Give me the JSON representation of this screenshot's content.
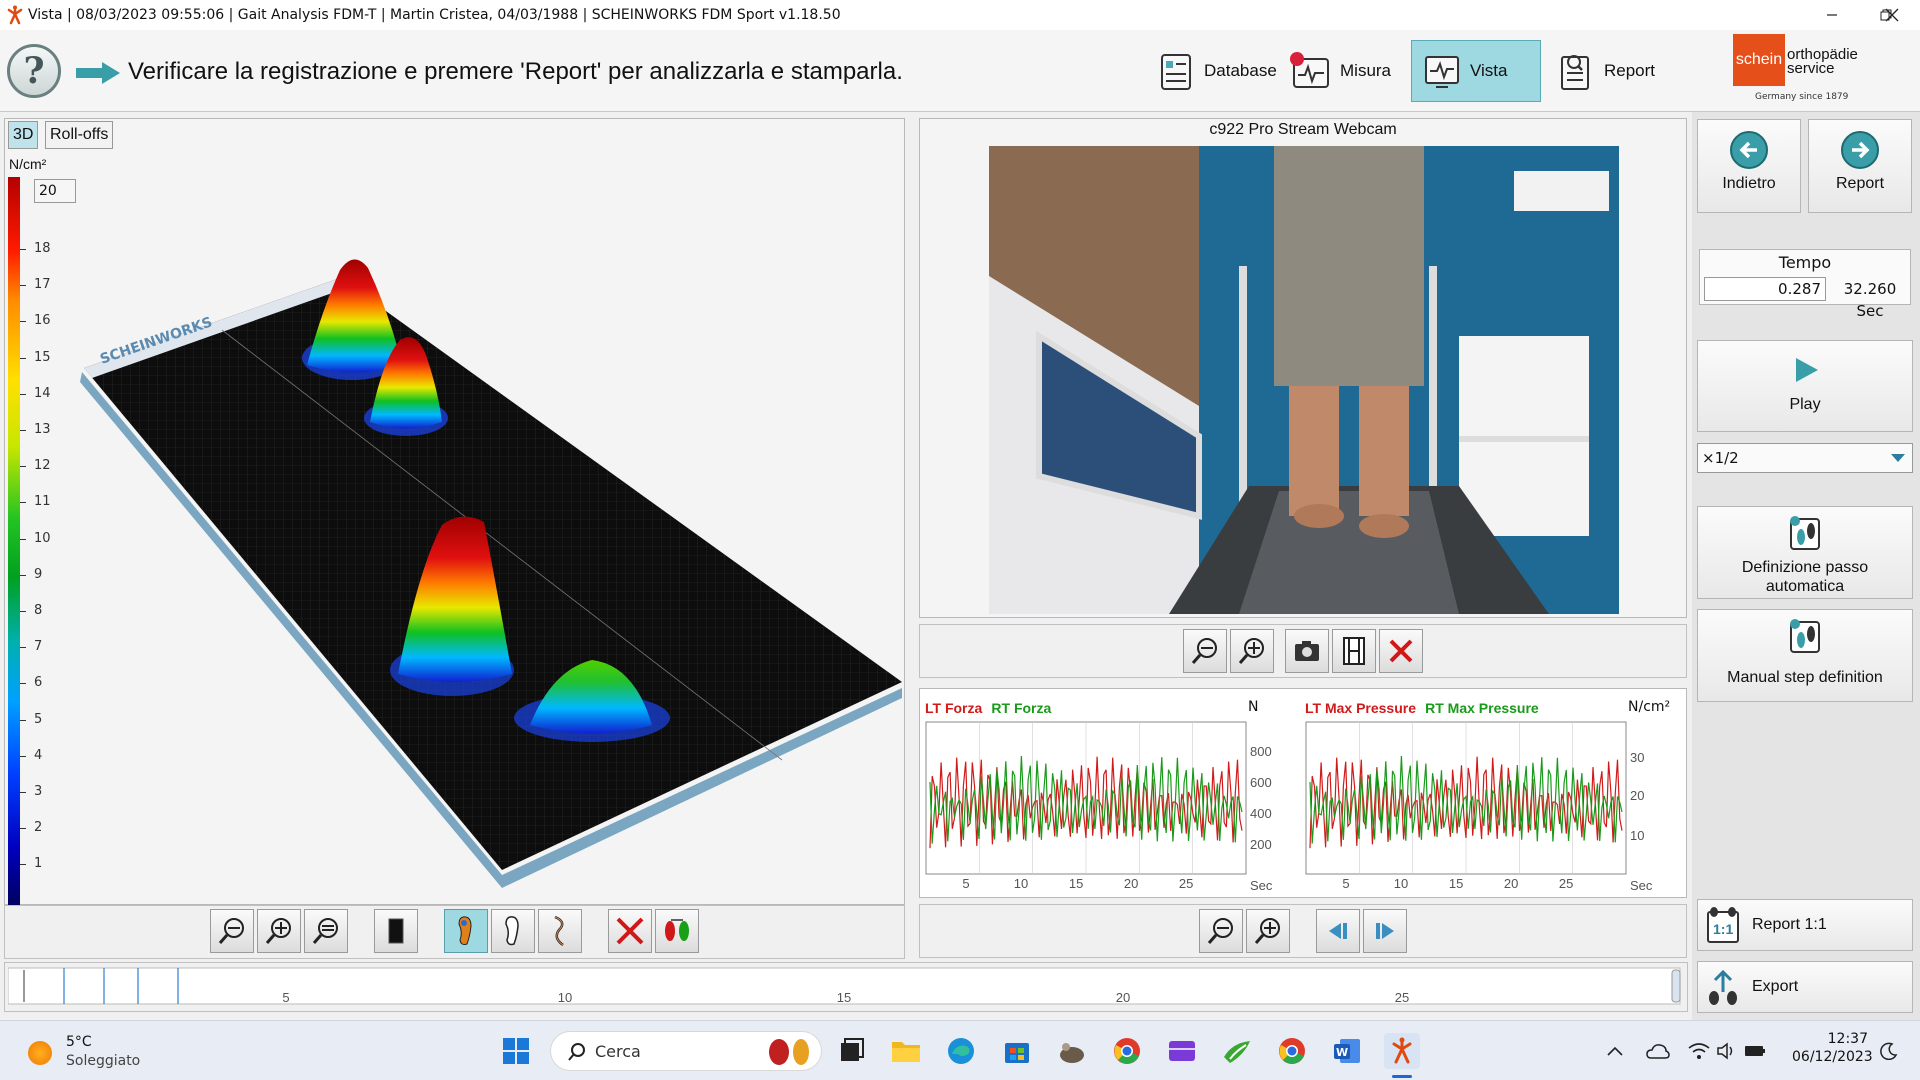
{
  "window": {
    "title": "Vista | 08/03/2023 09:55:06 | Gait Analysis FDM-T | Martin Cristea, 04/03/1988 | SCHEINWORKS FDM Sport v1.18.50"
  },
  "toolbar": {
    "instruction": "Verificare la registrazione e premere 'Report' per analizzarla e stamparla.",
    "nav": [
      "Database",
      "Misura",
      "Vista",
      "Report"
    ],
    "logo_left": "schein",
    "logo_right_1": "orthopädie",
    "logo_right_2": "service",
    "logo_sub": "Germany since 1879"
  },
  "left_panel": {
    "tabs": [
      "3D",
      "Roll-offs"
    ],
    "scale_unit": "N/cm²",
    "scale_max": "20",
    "scale_ticks": [
      "18",
      "17",
      "16",
      "15",
      "14",
      "13",
      "12",
      "11",
      "10",
      "9",
      "8",
      "7",
      "6",
      "5",
      "4",
      "3",
      "2",
      "1"
    ],
    "brand_text": "SCHEINWORKS"
  },
  "camera": {
    "title": "c922 Pro Stream Webcam"
  },
  "force_chart": {
    "lt_label": "LT Forza",
    "rt_label": "RT Forza",
    "unit": "N",
    "y_ticks": [
      "800",
      "600",
      "400",
      "200"
    ],
    "x_ticks": [
      "5",
      "10",
      "15",
      "20",
      "25"
    ],
    "x_unit": "Sec"
  },
  "pressure_chart": {
    "lt_label": "LT Max Pressure",
    "rt_label": "RT Max Pressure",
    "unit": "N/cm²",
    "y_ticks": [
      "30",
      "20",
      "10"
    ],
    "x_ticks": [
      "5",
      "10",
      "15",
      "20",
      "25"
    ],
    "x_unit": "Sec"
  },
  "timeline": {
    "ticks": [
      "5",
      "10",
      "15",
      "20",
      "25"
    ]
  },
  "sidebar": {
    "back_label": "Indietro",
    "report_label": "Report",
    "tempo_label": "Tempo",
    "tempo_current": "0.287",
    "tempo_total": "32.260 Sec",
    "play_label": "Play",
    "speed_value": "×1/2",
    "auto_step_1": "Definizione passo",
    "auto_step_2": "automatica",
    "manual_step": "Manual step definition",
    "report11_label": "Report 1:1",
    "export_label": "Export"
  },
  "taskbar": {
    "weather_temp": "5°C",
    "weather_desc": "Soleggiato",
    "search_placeholder": "Cerca",
    "time": "12:37",
    "date": "06/12/2023"
  },
  "colors": {
    "accent": "#9ed8e0",
    "lt_series": "#d11a1a",
    "rt_series": "#1a9a1a",
    "plate": "#0d0d0d"
  }
}
